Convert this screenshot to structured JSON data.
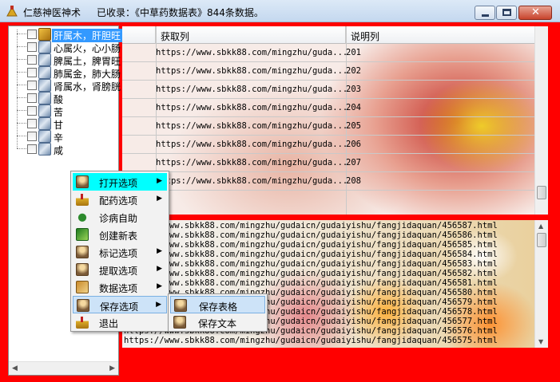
{
  "window": {
    "title": "仁慈神医神术",
    "status": "已收录：《中草药数据表》844条数据。",
    "buttons": {
      "minimize": "minimize",
      "maximize": "maximize",
      "close": "✕"
    }
  },
  "tree": {
    "items": [
      {
        "label": "肝属木，肝胆旺",
        "icon": "figure-icon",
        "selected": true
      },
      {
        "label": "心属火，心小肠",
        "icon": "figure-icon"
      },
      {
        "label": "脾属土，脾胃旺",
        "icon": "figure-icon"
      },
      {
        "label": "肺属金，肺大肠",
        "icon": "figure-icon"
      },
      {
        "label": "肾属水，肾膀胱",
        "icon": "figure-icon"
      },
      {
        "label": "酸",
        "icon": "figure-icon"
      },
      {
        "label": "苦",
        "icon": "figure-icon"
      },
      {
        "label": "甘",
        "icon": "figure-icon"
      },
      {
        "label": "辛",
        "icon": "figure-icon"
      },
      {
        "label": "咸",
        "icon": "figure-icon"
      }
    ]
  },
  "table": {
    "headers": [
      "获取列",
      "说明列"
    ],
    "rows": [
      {
        "url": "https://www.sbkk88.com/mingzhu/guda...",
        "id": "201"
      },
      {
        "url": "https://www.sbkk88.com/mingzhu/guda...",
        "id": "202"
      },
      {
        "url": "https://www.sbkk88.com/mingzhu/guda...",
        "id": "203"
      },
      {
        "url": "https://www.sbkk88.com/mingzhu/guda...",
        "id": "204"
      },
      {
        "url": "https://www.sbkk88.com/mingzhu/guda...",
        "id": "205"
      },
      {
        "url": "https://www.sbkk88.com/mingzhu/guda...",
        "id": "206"
      },
      {
        "url": "https://www.sbkk88.com/mingzhu/guda...",
        "id": "207"
      },
      {
        "url": "https://www.sbkk88.com/mingzhu/guda...",
        "id": "208"
      }
    ]
  },
  "textarea": {
    "lines": [
      "https://www.sbkk88.com/mingzhu/gudaicn/gudaiyishu/fangjidaquan/456587.html",
      "https://www.sbkk88.com/mingzhu/gudaicn/gudaiyishu/fangjidaquan/456586.html",
      "https://www.sbkk88.com/mingzhu/gudaicn/gudaiyishu/fangjidaquan/456585.html",
      "https://www.sbkk88.com/mingzhu/gudaicn/gudaiyishu/fangjidaquan/456584.html",
      "https://www.sbkk88.com/mingzhu/gudaicn/gudaiyishu/fangjidaquan/456583.html",
      "https://www.sbkk88.com/mingzhu/gudaicn/gudaiyishu/fangjidaquan/456582.html",
      "https://www.sbkk88.com/mingzhu/gudaicn/gudaiyishu/fangjidaquan/456581.html",
      "https://www.sbkk88.com/mingzhu/gudaicn/gudaiyishu/fangjidaquan/456580.html",
      "https://www.sbkk88.com/mingzhu/gudaicn/gudaiyishu/fangjidaquan/456579.html",
      "https://www.sbkk88.com/mingzhu/gudaicn/gudaiyishu/fangjidaquan/456578.html",
      "https://www.sbkk88.com/mingzhu/gudaicn/gudaiyishu/fangjidaquan/456577.html",
      "https://www.sbkk88.com/mingzhu/gudaicn/gudaiyishu/fangjidaquan/456576.html",
      "https://www.sbkk88.com/mingzhu/gudaicn/gudaiyishu/fangjidaquan/456575.html"
    ]
  },
  "context_menu": {
    "items": [
      {
        "label": "打开选项",
        "icon": "figure-icon",
        "submenu": true,
        "highlighted": true
      },
      {
        "label": "配药选项",
        "icon": "herb-bowl-icon",
        "submenu": true
      },
      {
        "label": "诊病自助",
        "icon": "hand-icon",
        "submenu": false
      },
      {
        "label": "创建新表",
        "icon": "plant-icon",
        "submenu": false
      },
      {
        "label": "标记选项",
        "icon": "figure-icon",
        "submenu": true
      },
      {
        "label": "提取选项",
        "icon": "figure-icon",
        "submenu": true
      },
      {
        "label": "数据选项",
        "icon": "herb-box-icon",
        "submenu": true
      },
      {
        "label": "保存选项",
        "icon": "figure-icon",
        "submenu": true,
        "active": true
      },
      {
        "label": "退出",
        "icon": "herb-bowl-icon",
        "submenu": false
      }
    ],
    "save_submenu": [
      {
        "label": "保存表格",
        "icon": "figure-icon",
        "selected": true
      },
      {
        "label": "保存文本",
        "icon": "figure-icon"
      }
    ]
  },
  "colors": {
    "client_background": "#ff0000",
    "selection": "#3399ff",
    "menu_highlight": "#00ffff"
  }
}
